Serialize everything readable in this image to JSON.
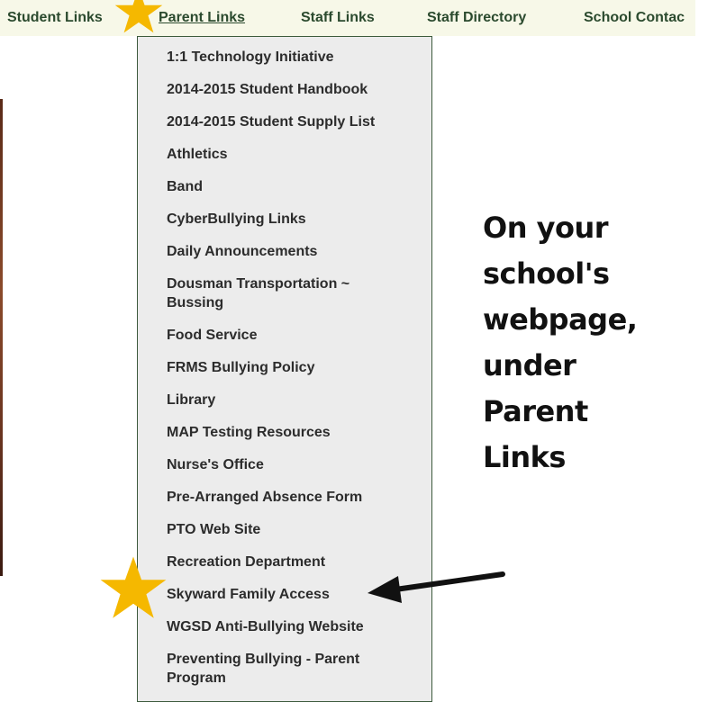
{
  "nav": {
    "items": [
      {
        "label": "Student Links"
      },
      {
        "label": "Parent Links"
      },
      {
        "label": "Staff Links"
      },
      {
        "label": "Staff Directory"
      },
      {
        "label": "School Contac"
      }
    ],
    "active_index": 1
  },
  "dropdown": {
    "items": [
      {
        "label": "1:1 Technology Initiative"
      },
      {
        "label": "2014-2015 Student Handbook"
      },
      {
        "label": "2014-2015 Student Supply List"
      },
      {
        "label": "Athletics"
      },
      {
        "label": "Band"
      },
      {
        "label": "CyberBullying Links"
      },
      {
        "label": "Daily Announcements"
      },
      {
        "label": "Dousman Transportation ~ Bussing"
      },
      {
        "label": "Food Service"
      },
      {
        "label": "FRMS Bullying Policy"
      },
      {
        "label": "Library"
      },
      {
        "label": "MAP Testing Resources"
      },
      {
        "label": "Nurse's Office"
      },
      {
        "label": "Pre-Arranged Absence Form"
      },
      {
        "label": "PTO Web Site"
      },
      {
        "label": "Recreation Department"
      },
      {
        "label": "Skyward Family Access"
      },
      {
        "label": "WGSD Anti-Bullying Website"
      },
      {
        "label": "Preventing Bullying - Parent Program"
      }
    ]
  },
  "annotation": {
    "lines": [
      "On your",
      "school's",
      "webpage,",
      "under",
      "Parent",
      "Links"
    ]
  },
  "colors": {
    "nav_bg": "#f7f8e8",
    "nav_text": "#2b4a2e",
    "menu_bg": "#ececec",
    "menu_text": "#2c2c2c",
    "star": "#f5b800"
  }
}
